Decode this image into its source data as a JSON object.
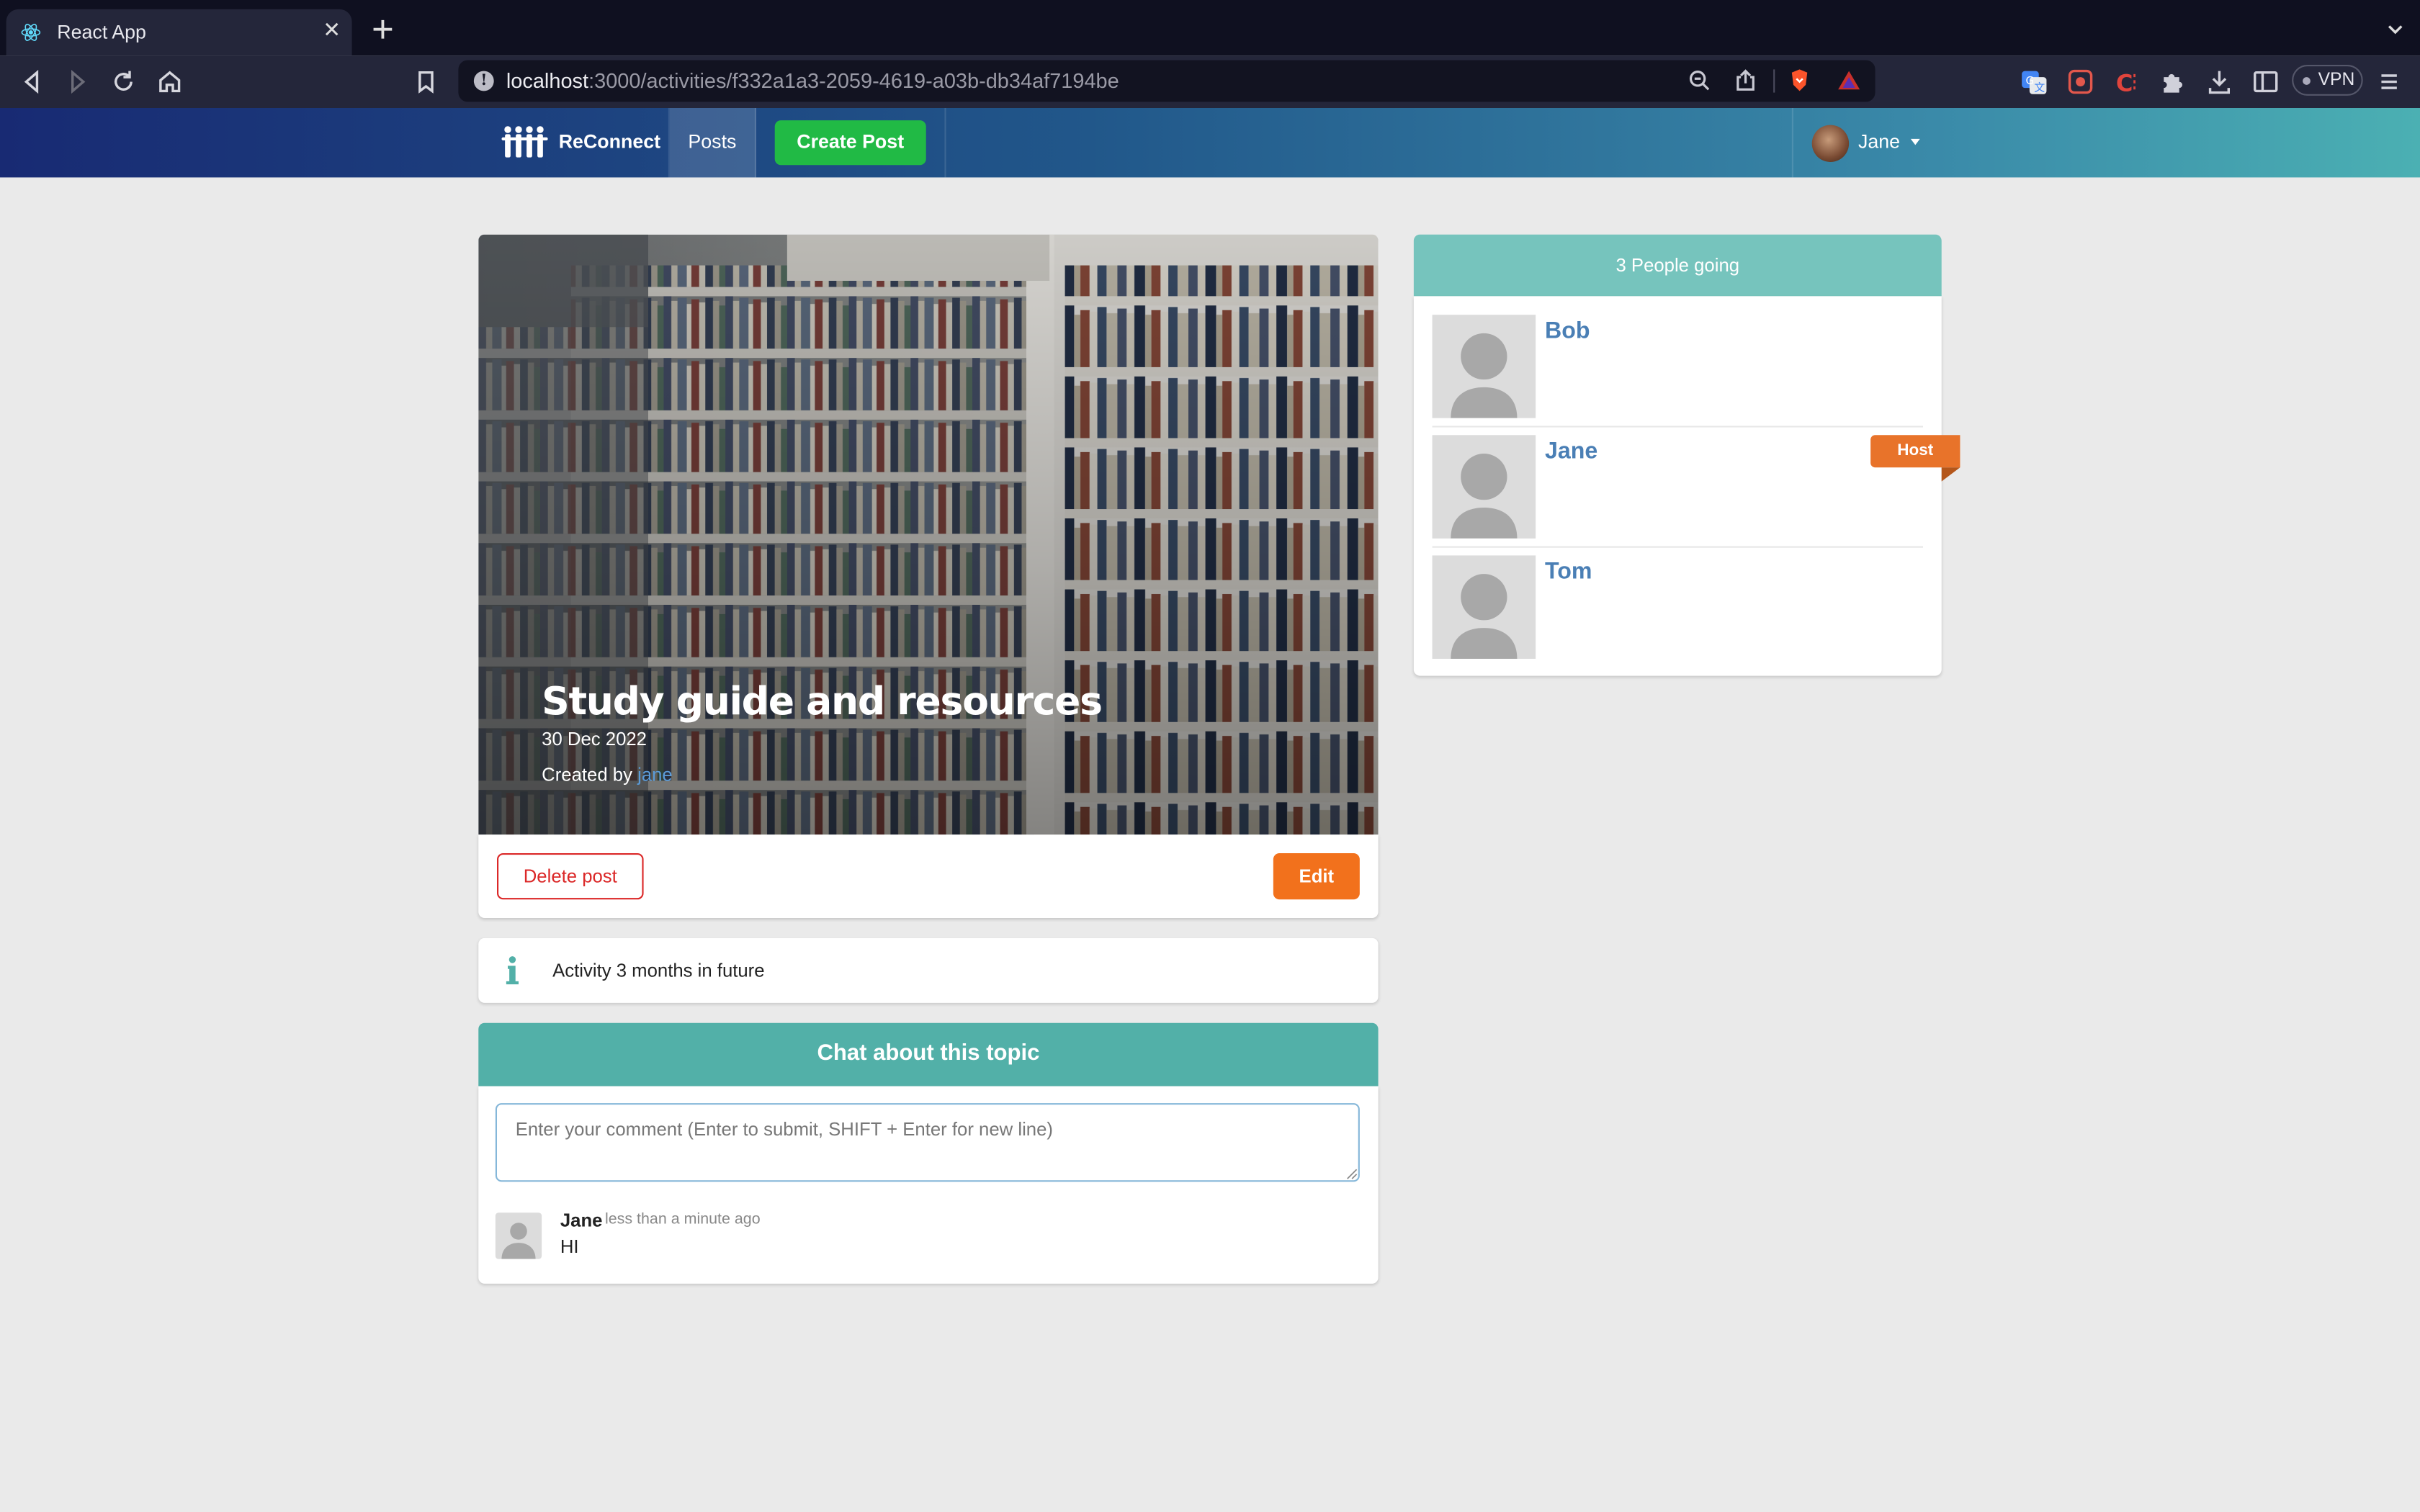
{
  "browser": {
    "tab_title": "React App",
    "url_host": "localhost",
    "url_path": ":3000/activities/f332a1a3-2059-4619-a03b-db34af7194be",
    "vpn_label": "VPN"
  },
  "navbar": {
    "brand": "ReConnect",
    "posts_label": "Posts",
    "create_post_label": "Create Post",
    "user_name": "Jane"
  },
  "activity": {
    "title": "Study guide and resources",
    "date": "30 Dec 2022",
    "created_by_prefix": "Created by ",
    "host_username": "jane",
    "delete_label": "Delete post",
    "edit_label": "Edit",
    "info_text": "Activity 3 months in future"
  },
  "chat": {
    "header": "Chat about this topic",
    "placeholder": "Enter your comment (Enter to submit, SHIFT + Enter for new line)",
    "comments": [
      {
        "author": "Jane",
        "time": "less than a minute ago",
        "body": "HI"
      }
    ]
  },
  "sidebar": {
    "header": "3 People going",
    "attendees": [
      {
        "name": "Bob"
      },
      {
        "name": "Jane"
      },
      {
        "name": "Tom"
      }
    ],
    "host_label": "Host"
  },
  "colors": {
    "create_post": "#21ba45",
    "edit": "#f2711c",
    "delete": "#db2828",
    "chat_header": "#52b0a8",
    "sidebar_header": "#76c4bd",
    "host_ribbon": "#e8732a",
    "attendee_name": "#4a7fb5"
  }
}
